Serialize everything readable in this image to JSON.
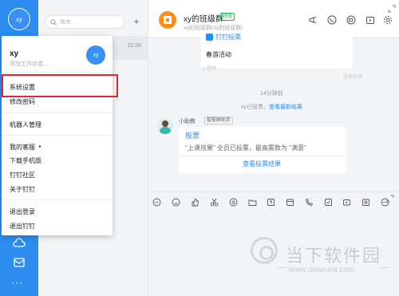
{
  "rail": {
    "avatar_text": "xy",
    "more": "···"
  },
  "list": {
    "search_placeholder": "搜索",
    "add": "+",
    "item_time": "20:38"
  },
  "menu": {
    "user_name": "xy",
    "user_status": "添加工作状态...",
    "avatar_text": "xy",
    "items": [
      "系统设置",
      "修改密码",
      "机器人管理",
      "我的客服",
      "下载手机版",
      "钉钉社区",
      "关于钉钉",
      "退出登录",
      "退出钉钉"
    ]
  },
  "header": {
    "title": "xy的班级群",
    "tag": "班级",
    "subtitle": "xy的班级群(xy的班级群)"
  },
  "messages": {
    "vote_card_title": "钉钉投票",
    "vote_card_text": "春游活动",
    "applet": "小程序",
    "all_read": "全部已读",
    "timestamp": "14分钟前",
    "system_prefix": "xy已投票，",
    "system_link": "查看最新结果",
    "bot_name": "小助教",
    "bot_tag": "智能群助手",
    "result_title": "投票",
    "result_desc": "\"上课效果\" 全员已投票，最高票数为 \"满意\"",
    "result_link": "查看投票结果"
  },
  "watermark": {
    "text": "当下软件园",
    "url": "www.downxia.com"
  },
  "colors": {
    "accent": "#2d8cf0",
    "highlight": "#e2262d",
    "group_avatar": "#ff8d1a",
    "group_tag": "#19b35c"
  }
}
